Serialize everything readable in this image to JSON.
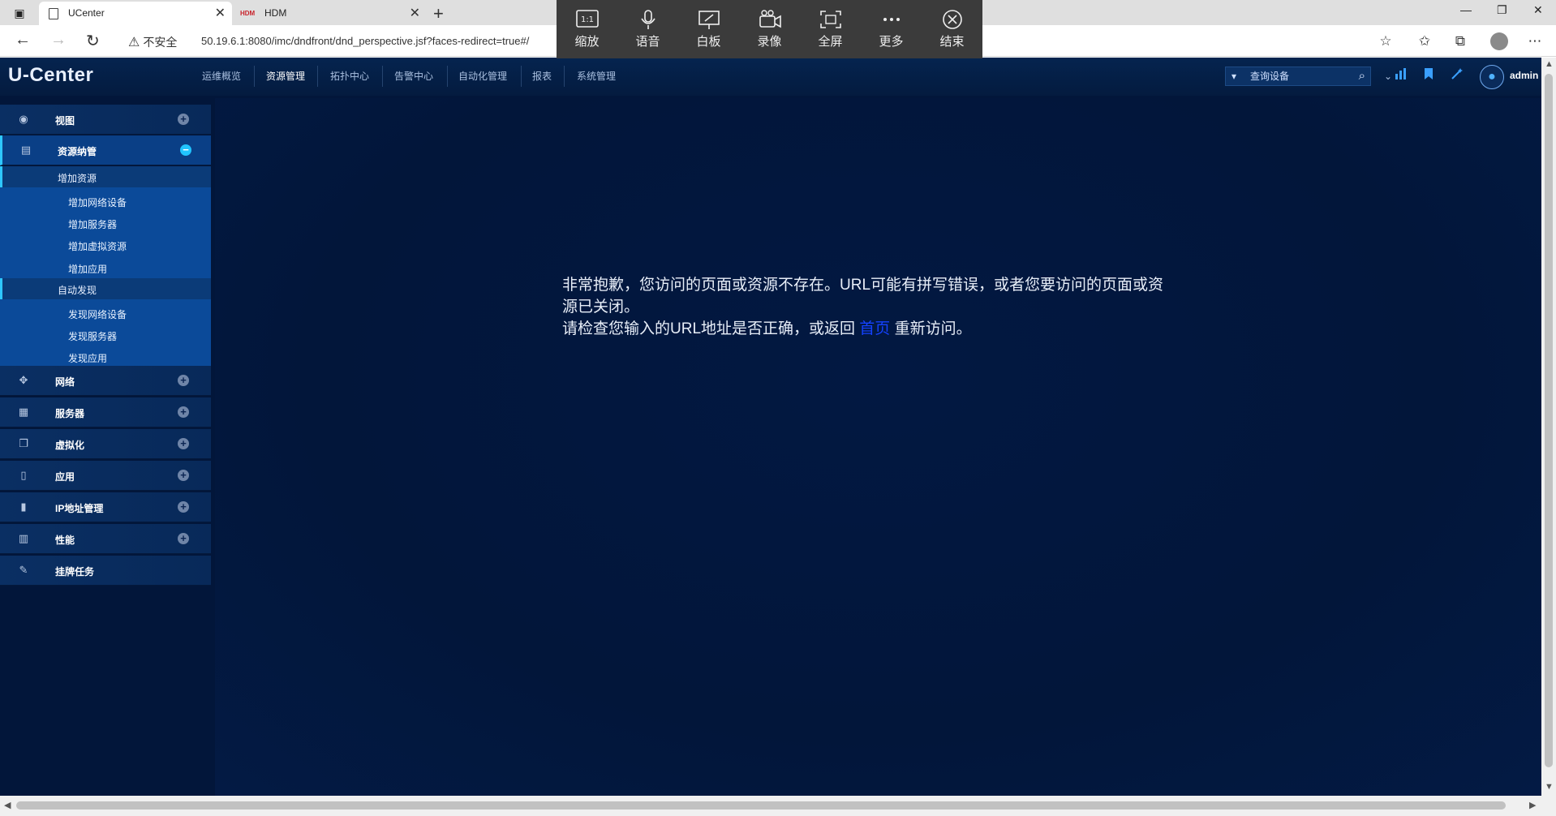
{
  "browser": {
    "tabs": [
      {
        "title": "UCenter"
      },
      {
        "title": "HDM",
        "favicon_text": "HDM"
      }
    ],
    "insecure_label": "不安全",
    "url": "50.19.6.1:8080/imc/dndfront/dnd_perspective.jsf?faces-redirect=true#/"
  },
  "meeting_toolbar": {
    "buttons": [
      {
        "label": "缩放",
        "icon": "zoom-1to1-icon"
      },
      {
        "label": "语音",
        "icon": "microphone-icon"
      },
      {
        "label": "白板",
        "icon": "whiteboard-icon"
      },
      {
        "label": "录像",
        "icon": "video-camera-icon"
      },
      {
        "label": "全屏",
        "icon": "fullscreen-icon"
      },
      {
        "label": "更多",
        "icon": "more-icon"
      },
      {
        "label": "结束",
        "icon": "end-icon"
      }
    ]
  },
  "app": {
    "logo": "U-Center",
    "nav": [
      "运维概览",
      "资源管理",
      "拓扑中心",
      "告警中心",
      "自动化管理",
      "报表",
      "系统管理"
    ],
    "nav_active": "资源管理",
    "search_placeholder": "查询设备",
    "user": "admin"
  },
  "sidebar": {
    "view": "视图",
    "resource_mgmt": "资源纳管",
    "add_resource": {
      "title": "增加资源",
      "items": [
        "增加网络设备",
        "增加服务器",
        "增加虚拟资源",
        "增加应用"
      ]
    },
    "auto_discovery": {
      "title": "自动发现",
      "items": [
        "发现网络设备",
        "发现服务器",
        "发现应用"
      ]
    },
    "network": "网络",
    "server": "服务器",
    "virtualization": "虚拟化",
    "application": "应用",
    "ip_mgmt": "IP地址管理",
    "performance": "性能",
    "tasks": "挂牌任务"
  },
  "error": {
    "line1": "非常抱歉，您访问的页面或资源不存在。URL可能有拼写错误，或者您要访问的页面或资",
    "line2": "源已关闭。",
    "line3_before": "请检查您输入的URL地址是否正确，或返回 ",
    "home_link": "首页",
    "line3_after": " 重新访问。"
  },
  "colors": {
    "app_bg": "#02163a",
    "header_bg": "#05244f",
    "sidebar_item_bg": "#0a2f63",
    "sidebar_sub_bg": "#0b4a99",
    "accent": "#2ec7ff",
    "link": "#1442ff"
  }
}
